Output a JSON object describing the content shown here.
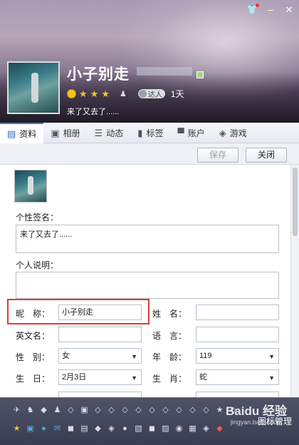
{
  "window": {
    "controls": [
      "shirt-icon",
      "minimize-icon",
      "close-icon"
    ]
  },
  "profile": {
    "nickname": "小子别走",
    "level_stars": 3,
    "daren_label": "达人",
    "days": "1天",
    "signature_line": "来了又去了......"
  },
  "tabs": [
    {
      "label": "资料",
      "icon": "profile-card-icon",
      "active": true
    },
    {
      "label": "相册",
      "icon": "photo-icon",
      "active": false
    },
    {
      "label": "动态",
      "icon": "feed-icon",
      "active": false
    },
    {
      "label": "标签",
      "icon": "bookmark-icon",
      "active": false
    },
    {
      "label": "账户",
      "icon": "briefcase-icon",
      "active": false
    },
    {
      "label": "游戏",
      "icon": "game-icon",
      "active": false
    }
  ],
  "toolbar": {
    "save_label": "保存",
    "close_label": "关闭"
  },
  "form": {
    "signature_label": "个性签名：",
    "signature_value": "来了又去了......",
    "description_label": "个人说明：",
    "description_value": "",
    "nickname_label": "昵　称：",
    "nickname_value": "小子别走",
    "surname_label": "姓　名：",
    "surname_value": "",
    "english_label": "英文名：",
    "english_value": "",
    "language_label": "语　言：",
    "language_value": "",
    "gender_label": "性　别：",
    "gender_value": "女",
    "age_label": "年　龄：",
    "age_value": "119",
    "birthday_label": "生　日：",
    "birthday_value": "2月3日",
    "zodiac_label": "生　肖：",
    "zodiac_value": "蛇"
  },
  "bottom": {
    "manage_label": "图标管理",
    "watermark": "Baidu 经验",
    "watermark_sub": "jingyan.baidu.com"
  },
  "colors": {
    "accent": "#4a7ab8",
    "highlight": "#e53935"
  }
}
